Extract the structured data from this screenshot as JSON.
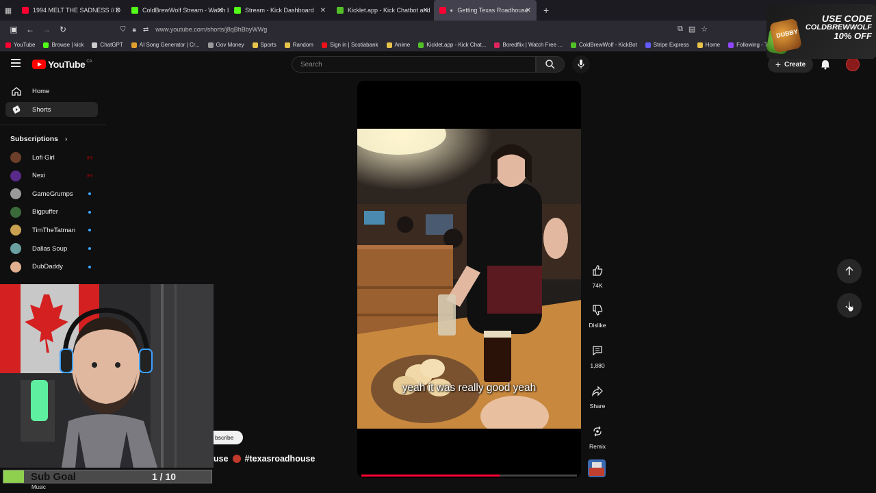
{
  "browser": {
    "tabs": [
      {
        "label": "1994 MELT THE SADNESS // D",
        "fav": "#ff0033"
      },
      {
        "label": "ColdBrewWolf Stream - Watch L",
        "fav": "#53fc18"
      },
      {
        "label": "Stream - Kick Dashboard",
        "fav": "#53fc18"
      },
      {
        "label": "Kicklet.app - Kick Chatbot and",
        "fav": "#53c028"
      },
      {
        "label": "Getting Texas Roadhouse",
        "fav": "#ff0033"
      }
    ],
    "url": "www.youtube.com/shorts/j8qBhBbyWWg",
    "bookmarks": [
      {
        "label": "YouTube",
        "color": "#ff0033"
      },
      {
        "label": "Browse | kick",
        "color": "#53fc18"
      },
      {
        "label": "ChatGPT",
        "color": "#cccccc"
      },
      {
        "label": "AI Song Generator | Cr...",
        "color": "#e0a030"
      },
      {
        "label": "Gov Money",
        "color": "#999999"
      },
      {
        "label": "Sports",
        "color": "#e6c34a"
      },
      {
        "label": "Random",
        "color": "#e6c34a"
      },
      {
        "label": "Sign in | Scotiabank",
        "color": "#ec111a"
      },
      {
        "label": "Anime",
        "color": "#e6c34a"
      },
      {
        "label": "Kicklet.app - Kick Chat...",
        "color": "#53c028"
      },
      {
        "label": "Boredflix | Watch Free ...",
        "color": "#e0245e"
      },
      {
        "label": "ColdBrewWolf - KickBot",
        "color": "#53c028"
      },
      {
        "label": "Stripe Express",
        "color": "#635bff"
      },
      {
        "label": "Home",
        "color": "#e6c34a"
      },
      {
        "label": "Following - Twitch",
        "color": "#9146ff"
      }
    ]
  },
  "header": {
    "logo": "YouTube",
    "region": "CA",
    "search_placeholder": "Search",
    "create_label": "Create"
  },
  "sidebar": {
    "home": "Home",
    "shorts": "Shorts",
    "subscriptions_title": "Subscriptions",
    "subscriptions": [
      {
        "name": "Lofi Girl",
        "status": "live",
        "color": "#6b3f2a"
      },
      {
        "name": "Nexi",
        "status": "live",
        "color": "#5a2a8a"
      },
      {
        "name": "GameGrumps",
        "status": "new",
        "color": "#999999"
      },
      {
        "name": "Bigpuffer",
        "status": "new",
        "color": "#3a6a3a"
      },
      {
        "name": "TimTheTatman",
        "status": "new",
        "color": "#c8a050"
      },
      {
        "name": "Dallas Soup",
        "status": "new",
        "color": "#6aa0a0"
      },
      {
        "name": "DubDaddy",
        "status": "new",
        "color": "#e0b090"
      }
    ]
  },
  "player": {
    "caption": "yeah it was really good yeah",
    "progress": 0.64
  },
  "actions": {
    "likes": "74K",
    "dislike": "Dislike",
    "comments": "1,880",
    "share": "Share",
    "remix": "Remix"
  },
  "overlay": {
    "promo_line1": "USE CODE",
    "promo_line2": "COLDBREWWOLF",
    "promo_line3": "10% OFF",
    "promo_brand": "DUBBY",
    "subgoal_label": "Sub Goal",
    "subgoal_count": "1 / 10",
    "subgoal_progress": 0.1,
    "music_label": "Music",
    "subscribe_partial": "bscribe",
    "title_prefix": "use",
    "hashtag": "#texasroadhouse"
  }
}
